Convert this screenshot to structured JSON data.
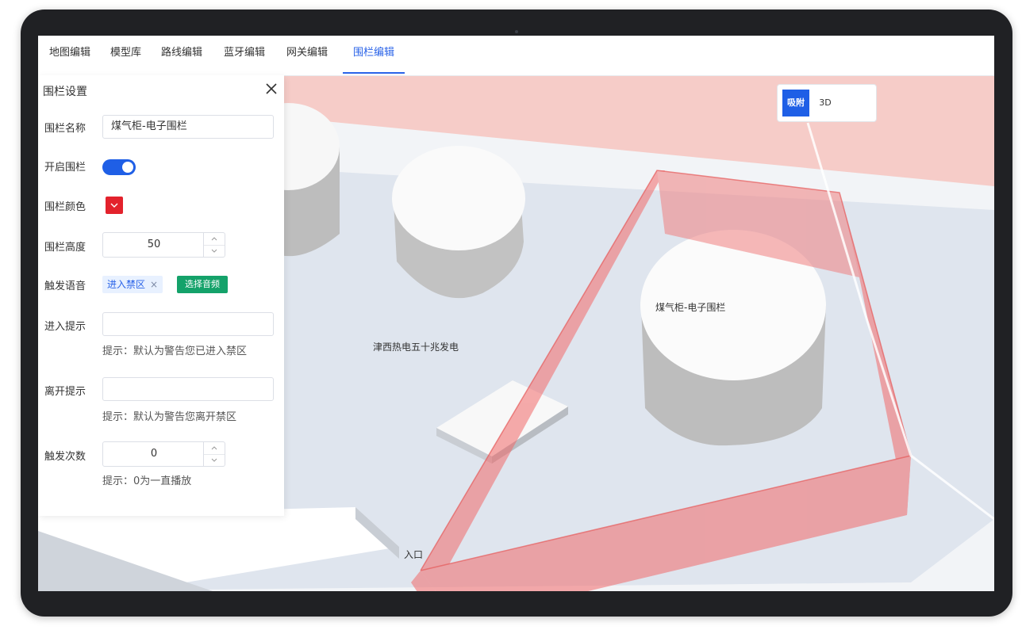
{
  "tabs": [
    {
      "label": "地图编辑"
    },
    {
      "label": "模型库"
    },
    {
      "label": "路线编辑"
    },
    {
      "label": "蓝牙编辑"
    },
    {
      "label": "网关编辑"
    },
    {
      "label": "围栏编辑",
      "active": true
    }
  ],
  "view_toggle": {
    "snap_label": "吸附",
    "mode_3d_label": "3D",
    "active": "吸附"
  },
  "panel": {
    "title": "围栏设置",
    "name_label": "围栏名称",
    "name_value": "煤气柜-电子围栏",
    "enable_label": "开启围栏",
    "enabled": true,
    "color_label": "围栏颜色",
    "color_value": "#e3222c",
    "height_label": "围栏高度",
    "height_value": "50",
    "voice_label": "触发语音",
    "voice_tag": "进入禁区",
    "voice_tag_close": "×",
    "select_audio_button": "选择音频",
    "enter_label": "进入提示",
    "enter_value": "",
    "enter_hint": "提示：默认为警告您已进入禁区",
    "leave_label": "离开提示",
    "leave_value": "",
    "leave_hint": "提示：默认为警告您离开禁区",
    "count_label": "触发次数",
    "count_value": "0",
    "count_hint": "提示：0为一直播放"
  },
  "map": {
    "labels": {
      "gas_tank": "煤气柜-电子围栏",
      "plant": "津西热电五十兆发电",
      "entrance": "入口"
    },
    "fence_color": "#f26a6a"
  },
  "icons": {
    "close": "close-icon",
    "chevron_up": "chevron-up-icon",
    "chevron_down": "chevron-down-icon",
    "dropdown": "chevron-down-icon"
  }
}
